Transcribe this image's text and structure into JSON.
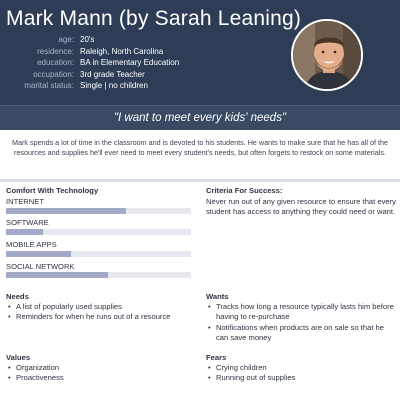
{
  "persona": {
    "name": "Mark Mann (by Sarah Leaning)",
    "facts": [
      {
        "key": "age:",
        "value": "20's"
      },
      {
        "key": "residence:",
        "value": "Raleigh, North Carolina"
      },
      {
        "key": "education:",
        "value": "BA in Elementary Education"
      },
      {
        "key": "occupation:",
        "value": "3rd grade Teacher"
      },
      {
        "key": "marital status:",
        "value": "Single | no children"
      }
    ],
    "quote": "\"I want to meet every kids' needs\"",
    "bio": "Mark spends a lot of time in the classroom and is devoted to his students. He wants to make sure that he has all of the resources and supplies he'll ever need to meet every student's needs, but often forgets to restock on some materials."
  },
  "colors": {
    "header_bg": "#2e3d55",
    "quote_bg": "#3a4a63",
    "bar_fill": "#a5a9c8",
    "bar_track": "#e6e8ee"
  },
  "tech": {
    "heading": "Comfort With Technology",
    "items": [
      {
        "label": "INTERNET",
        "level": 0.65
      },
      {
        "label": "SOFTWARE",
        "level": 0.2
      },
      {
        "label": "MOBILE APPS",
        "level": 0.35
      },
      {
        "label": "SOCIAL NETWORK",
        "level": 0.55
      }
    ]
  },
  "criteria": {
    "heading": "Criteria For Success:",
    "text": "Never run out of any given resource to ensure that every student has access to anything they could need or want."
  },
  "needs": {
    "heading": "Needs",
    "items": [
      "A list of popularly used supplies",
      "Reminders for when he runs out of a resource"
    ]
  },
  "wants": {
    "heading": "Wants",
    "items": [
      "Tracks how long a resource typically lasts him before having to re-purchase",
      "Notifications when products are on sale so that he can save money"
    ]
  },
  "values": {
    "heading": "Values",
    "items": [
      "Organization",
      "Proactiveness"
    ]
  },
  "fears": {
    "heading": "Fears",
    "items": [
      "Crying children",
      "Running out of supplies"
    ]
  }
}
